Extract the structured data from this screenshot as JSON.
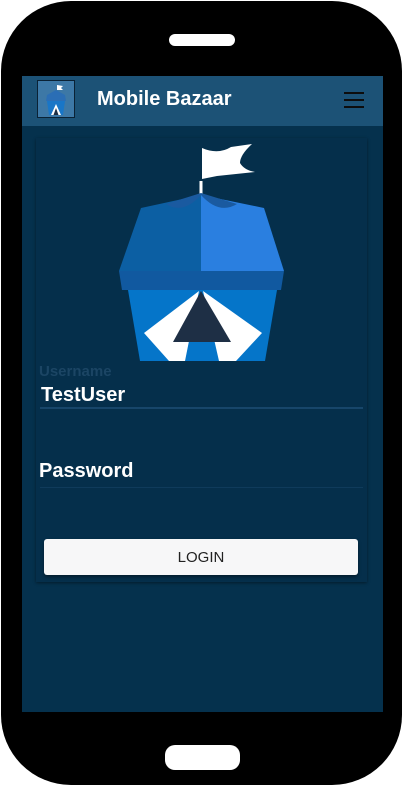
{
  "app": {
    "title": "Mobile Bazaar",
    "logo_icon": "openbazaar-tent-icon",
    "menu_icon": "hamburger-menu-icon"
  },
  "login": {
    "logo_icon": "openbazaar-tent-icon",
    "username_label": "Username",
    "username_value": "TestUser",
    "password_label": "Password",
    "password_value": "",
    "submit_label": "LOGIN"
  },
  "colors": {
    "screen_background": "#05314d",
    "app_bar": "#1c5276",
    "button_background": "#f7f7f8",
    "tent_dark_blue": "#1565ab",
    "tent_light_blue": "#2a7fe0",
    "flag": "#ffffff"
  }
}
